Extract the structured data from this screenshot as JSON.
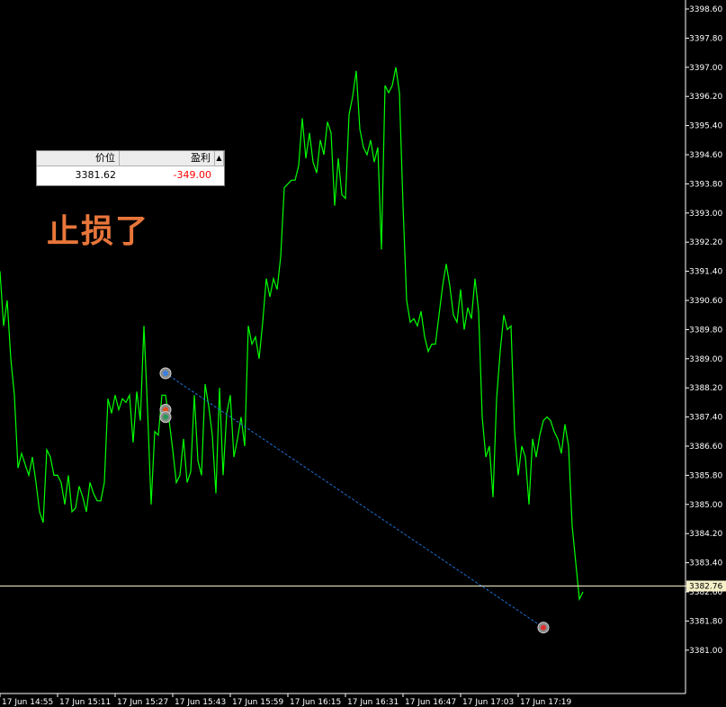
{
  "annotation": "止损了",
  "trade_table": {
    "headers": [
      "价位",
      "盈利"
    ],
    "scroll_arrow": "▲",
    "price": "3381.62",
    "profit": "-349.00",
    "profit_color": "#ff0000"
  },
  "current_price_label": "3382.76",
  "colors": {
    "background": "#000000",
    "price_line": "#00ff00",
    "current_price_line": "#f5f0c8",
    "trade_line": "#1e6fd0",
    "axis": "#ffffff"
  },
  "chart_data": {
    "type": "line",
    "title": "",
    "ylim": [
      3380.6,
      3398.6
    ],
    "y_ticks": [
      "3381.00",
      "3381.80",
      "3382.60",
      "3383.40",
      "3384.20",
      "3385.00",
      "3385.80",
      "3386.60",
      "3387.40",
      "3388.20",
      "3389.00",
      "3389.80",
      "3390.60",
      "3391.40",
      "3392.20",
      "3393.00",
      "3393.80",
      "3394.60",
      "3395.40",
      "3396.20",
      "3397.00",
      "3397.80",
      "3398.60"
    ],
    "x_ticks": [
      "17 Jun 14:55",
      "17 Jun 15:11",
      "17 Jun 15:27",
      "17 Jun 15:43",
      "17 Jun 15:59",
      "17 Jun 16:15",
      "17 Jun 16:31",
      "17 Jun 16:47",
      "17 Jun 17:03",
      "17 Jun 17:19"
    ],
    "x_tick_bars": [
      0,
      16,
      32,
      48,
      64,
      80,
      96,
      112,
      128,
      144
    ],
    "series": [
      {
        "values": [
          3391.4,
          3389.9,
          3390.6,
          3389.0,
          3388.0,
          3386.0,
          3386.4,
          3386.1,
          3385.8,
          3386.3,
          3385.6,
          3384.8,
          3384.5,
          3386.5,
          3386.3,
          3385.8,
          3385.8,
          3385.6,
          3385.0,
          3385.8,
          3384.8,
          3384.9,
          3385.5,
          3385.2,
          3384.8,
          3385.6,
          3385.3,
          3385.1,
          3385.1,
          3385.6,
          3387.9,
          3387.5,
          3388.0,
          3387.6,
          3387.9,
          3387.8,
          3388.0,
          3386.7,
          3388.1,
          3387.3,
          3389.9,
          3387.6,
          3385.0,
          3387.0,
          3386.9,
          3388.0,
          3388.0,
          3387.3,
          3386.5,
          3385.6,
          3385.8,
          3386.8,
          3385.6,
          3385.9,
          3388.0,
          3386.2,
          3385.8,
          3388.3,
          3387.7,
          3386.9,
          3385.3,
          3388.2,
          3385.8,
          3387.5,
          3388.0,
          3386.3,
          3386.8,
          3387.4,
          3386.6,
          3389.9,
          3389.4,
          3389.6,
          3389.0,
          3390.0,
          3391.2,
          3390.7,
          3391.2,
          3390.9,
          3391.8,
          3393.7,
          3393.8,
          3393.9,
          3393.9,
          3394.3,
          3395.6,
          3394.5,
          3395.2,
          3394.4,
          3394.1,
          3395.0,
          3394.6,
          3395.5,
          3395.2,
          3393.2,
          3394.5,
          3393.5,
          3393.4,
          3395.7,
          3396.2,
          3396.9,
          3395.3,
          3394.8,
          3394.6,
          3395.0,
          3394.4,
          3394.8,
          3392.0,
          3396.5,
          3396.3,
          3396.5,
          3397.0,
          3396.3,
          3393.2,
          3390.6,
          3390.0,
          3390.1,
          3389.9,
          3390.3,
          3389.6,
          3389.2,
          3389.4,
          3389.4,
          3390.2,
          3391.0,
          3391.6,
          3391.0,
          3390.2,
          3390.0,
          3390.9,
          3389.8,
          3390.4,
          3390.1,
          3391.2,
          3390.3,
          3387.4,
          3386.3,
          3386.6,
          3385.2,
          3387.9,
          3389.2,
          3390.2,
          3389.8,
          3389.9,
          3387.0,
          3385.8,
          3386.6,
          3386.3,
          3385.0,
          3386.8,
          3386.3,
          3386.9,
          3387.3,
          3387.4,
          3387.3,
          3387.0,
          3386.8,
          3386.4,
          3387.2,
          3386.6,
          3384.4,
          3383.4,
          3382.4,
          3382.6
        ],
        "color": "#00ff00"
      }
    ],
    "trade": {
      "entry_bar": 46,
      "entry_price": 3388.6,
      "exit_bar": 151,
      "exit_price": 3381.62,
      "extra_markers": [
        {
          "bar": 46,
          "price": 3387.6
        },
        {
          "bar": 46,
          "price": 3387.4
        }
      ]
    },
    "current_price": 3382.76,
    "grid": false
  }
}
